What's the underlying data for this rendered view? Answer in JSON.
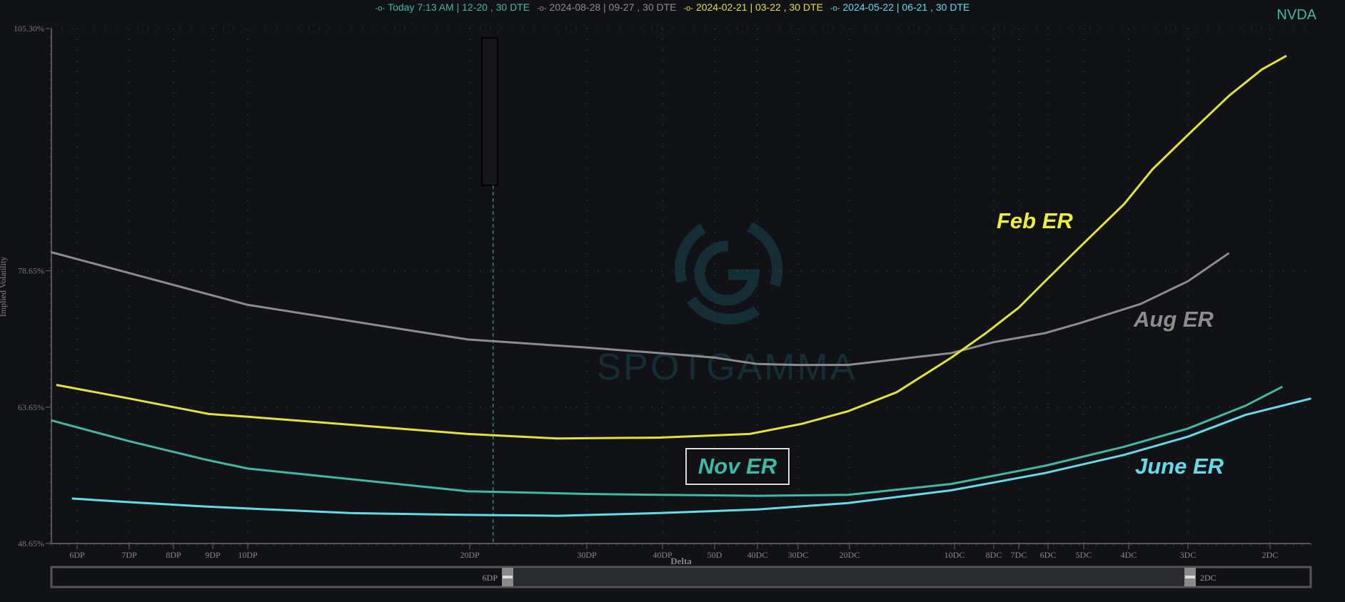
{
  "ticker": "NVDA",
  "legend": [
    {
      "label": "Today 7:13 AM | 12-20 , 30 DTE",
      "color": "#3fb8a4"
    },
    {
      "label": "2024-08-28 | 09-27 , 30 DTE",
      "color": "#8c8c8c"
    },
    {
      "label": "2024-02-21 | 03-22 , 30 DTE",
      "color": "#e2e23a"
    },
    {
      "label": "2024-05-22 | 06-21 , 30 DTE",
      "color": "#62dcea"
    }
  ],
  "annotations": {
    "feb": "Feb ER",
    "aug": "Aug ER",
    "nov": "Nov ER",
    "june": "June ER"
  },
  "watermark": "SPOTGAMMA",
  "range_slider": {
    "left_label": "6DP",
    "right_label": "2DC"
  },
  "chart_data": {
    "type": "line",
    "title": "",
    "xlabel": "Delta",
    "ylabel": "Implied Volatility",
    "x_units": "call-equivalent delta (%)",
    "ylim": [
      48.65,
      105.3
    ],
    "yticks": [
      "48.65%",
      "63.65%",
      "78.65%",
      "105.30%"
    ],
    "ytick_values": [
      48.65,
      63.65,
      78.65,
      105.3
    ],
    "xticks": [
      {
        "label": "6DP",
        "x": 94
      },
      {
        "label": "7DP",
        "x": 93
      },
      {
        "label": "8DP",
        "x": 92
      },
      {
        "label": "9DP",
        "x": 91
      },
      {
        "label": "10DP",
        "x": 90
      },
      {
        "label": "20DP",
        "x": 80
      },
      {
        "label": "30DP",
        "x": 70
      },
      {
        "label": "40DP",
        "x": 60
      },
      {
        "label": "50D",
        "x": 50
      },
      {
        "label": "40DC",
        "x": 40
      },
      {
        "label": "30DC",
        "x": 30
      },
      {
        "label": "20DC",
        "x": 20
      },
      {
        "label": "10DC",
        "x": 10
      },
      {
        "label": "8DC",
        "x": 8
      },
      {
        "label": "7DC",
        "x": 7
      },
      {
        "label": "6DC",
        "x": 6
      },
      {
        "label": "5DC",
        "x": 5
      },
      {
        "label": "4DC",
        "x": 4
      },
      {
        "label": "3DC",
        "x": 3
      },
      {
        "label": "2DC",
        "x": 2
      }
    ],
    "grid": "dotted",
    "crosshair_x": 78,
    "series": [
      {
        "name": "Today 7:13 AM | 12-20 , 30 DTE",
        "color": "#3fb8a4",
        "x": [
          94.5,
          93,
          91.1,
          90,
          80.1,
          70,
          60.4,
          40,
          20.3,
          10.3,
          6.1,
          4.1,
          3.0,
          2.3,
          1.85
        ],
        "y": [
          62.2,
          59.9,
          57.8,
          56.9,
          54.4,
          54.1,
          54.0,
          53.9,
          54.0,
          55.2,
          57.2,
          59.3,
          61.3,
          63.8,
          65.9
        ]
      },
      {
        "name": "2024-08-28 | 09-27 , 30 DTE",
        "color": "#8c8c8c",
        "x": [
          94.5,
          93,
          90,
          80.1,
          70,
          60.4,
          50,
          40,
          30.3,
          20.3,
          10.3,
          8,
          6.1,
          5.1,
          3.8,
          3.0,
          2.5
        ],
        "y": [
          80.7,
          78.4,
          74.9,
          71.1,
          70.2,
          69.6,
          69.1,
          68.4,
          68.3,
          68.3,
          69.6,
          70.8,
          71.8,
          72.9,
          75.0,
          77.5,
          80.6
        ]
      },
      {
        "name": "2024-02-21 | 03-22 , 30 DTE",
        "color": "#e2e23a",
        "x": [
          94.4,
          93,
          91.1,
          90,
          80.1,
          72.5,
          60.4,
          41.8,
          29.4,
          20.3,
          15.5,
          10.3,
          8.4,
          7,
          6.1,
          5.1,
          4.1,
          3.6,
          3.0,
          2.5,
          2.1,
          1.8
        ],
        "y": [
          66.1,
          64.6,
          62.9,
          62.6,
          60.7,
          60.2,
          60.3,
          60.7,
          61.8,
          63.2,
          65.3,
          69.1,
          71.8,
          74.6,
          77.5,
          81.3,
          86.0,
          89.8,
          93.6,
          97.9,
          100.8,
          102.3
        ]
      },
      {
        "name": "2024-05-22 | 06-21 , 30 DTE",
        "color": "#62dcea",
        "x": [
          94.1,
          93,
          91.1,
          90,
          85.4,
          80.1,
          72.5,
          60.4,
          40,
          20.3,
          10.3,
          6.1,
          4.1,
          3.0,
          2.3,
          1.5
        ],
        "y": [
          53.6,
          53.2,
          52.7,
          52.5,
          52.0,
          51.8,
          51.7,
          52.0,
          52.4,
          53.1,
          54.5,
          56.4,
          58.4,
          60.4,
          62.8,
          64.6
        ]
      }
    ],
    "legend_position": "top-center"
  }
}
